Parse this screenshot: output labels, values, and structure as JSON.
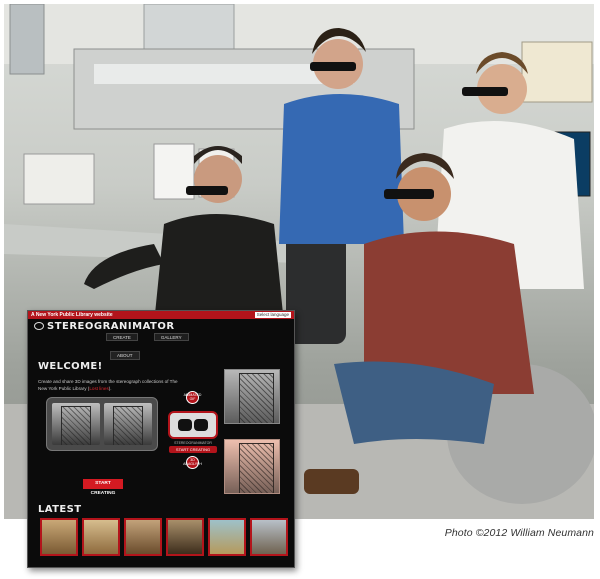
{
  "photo": {
    "credit": "Photo ©2012 William Neumann"
  },
  "inset": {
    "nypl_link": "A New York Public Library website",
    "language": "Select language",
    "brand": "STEREOGRANIMATOR",
    "nav": {
      "create": "CREATE",
      "gallery": "GALLERY",
      "about": "ABOUT"
    },
    "welcome": "WELCOME!",
    "intro_text": "Create and share 3D images from the stereograph collections of The New York Public Library (",
    "intro_link": "Lost lines",
    "intro_end": ").",
    "viewer_label": "STEREOGRANIMATOR",
    "badge_gif": "ANIMATED GIF",
    "badge_anaglyph": "3D ANAGLYPH",
    "start_small": "START CREATING",
    "start_button": "START CREATING",
    "latest": "LATEST"
  },
  "colors": {
    "brand_red": "#b3141b",
    "inset_bg": "#0b0b0b"
  }
}
